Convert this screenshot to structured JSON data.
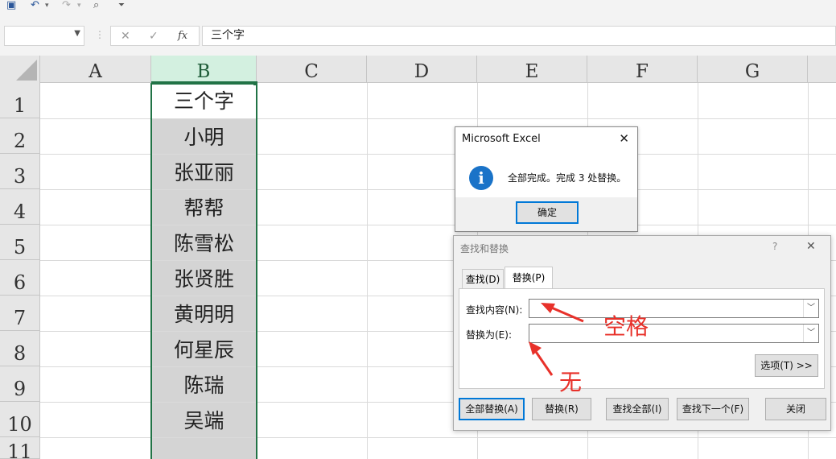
{
  "formula_bar": {
    "name_box": "",
    "fx_label": "fx",
    "content": "三个字"
  },
  "columns": [
    "A",
    "B",
    "C",
    "D",
    "E",
    "F",
    "G"
  ],
  "rows": [
    "1",
    "2",
    "3",
    "4",
    "5",
    "6",
    "7",
    "8",
    "9",
    "10",
    "11"
  ],
  "column_b_cells": [
    "三个字",
    "小明",
    "张亚丽",
    "帮帮",
    "陈雪松",
    "张贤胜",
    "黄明明",
    "何星辰",
    "陈瑞",
    "吴端",
    ""
  ],
  "message_box": {
    "title": "Microsoft Excel",
    "message": "全部完成。完成 3 处替换。",
    "ok_button": "确定",
    "icon": "info-icon"
  },
  "find_replace": {
    "title": "查找和替换",
    "help": "?",
    "tabs": [
      {
        "label": "查找(D)"
      },
      {
        "label": "替换(P)",
        "active": true
      }
    ],
    "find_label": "查找内容(N):",
    "find_value": "",
    "replace_label": "替换为(E):",
    "replace_value": "",
    "options_button": "选项(T) >>",
    "buttons": [
      "全部替换(A)",
      "替换(R)",
      "查找全部(I)",
      "查找下一个(F)",
      "关闭"
    ]
  },
  "annotations": {
    "space": "空格",
    "none": "无"
  },
  "colors": {
    "selection_border": "#217346",
    "header_selected": "#d3f0e0",
    "annotation": "#e8312a",
    "info_icon": "#1a73c8"
  }
}
